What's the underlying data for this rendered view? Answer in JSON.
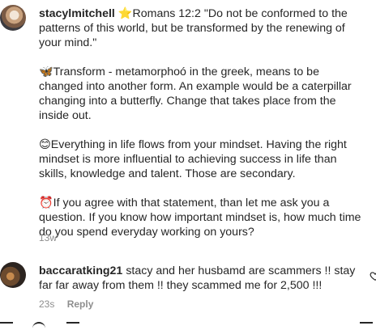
{
  "comments": [
    {
      "username": "stacylmitchell",
      "body": "⭐Romans 12:2 \"Do not be conformed to the patterns of this world, but be transformed by the renewing of your mind.\"\n\n🦋Transform - metamorphoó in the greek, means to be changed into another form. An example would be a caterpillar changing into a butterfly. Change that takes place from the inside out.\n\n😊Everything in life flows from your mindset. Having the right mindset is more influential to achieving success in life than skills, knowledge and talent. Those are secondary.\n\n⏰If you agree with that statement, than let me ask you a question. If you know how important mindset is, how much time do you spend everyday working on yours?",
      "time": "13w"
    },
    {
      "username": "baccaratking21",
      "body": "stacy and her husbamd are scammers !! stay far far away from them !! they scammed me for 2,500 !!!",
      "time": "23s",
      "reply_label": "Reply"
    }
  ],
  "icons": {
    "like": "heart-icon"
  }
}
